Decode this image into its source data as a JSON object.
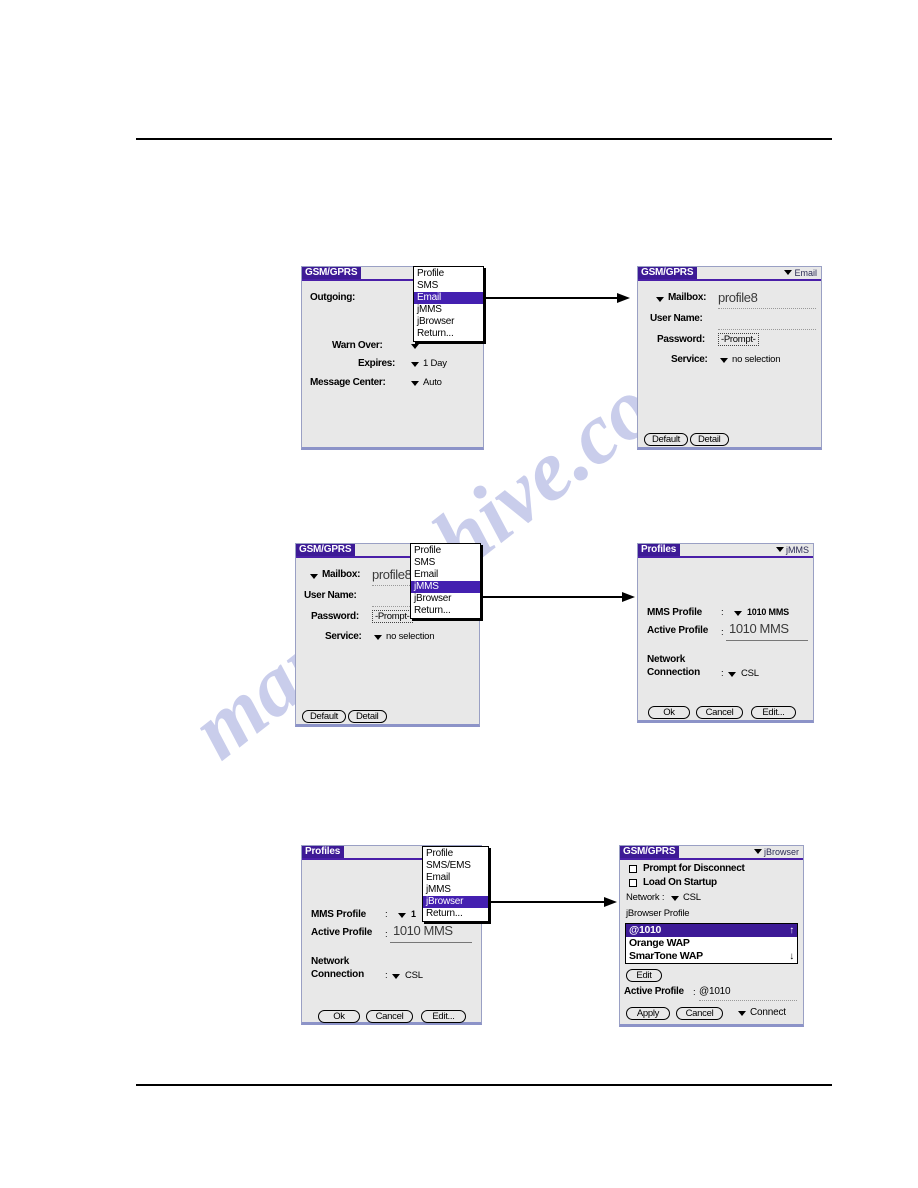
{
  "page": {
    "watermark": "manualshive.com"
  },
  "panels": [
    {
      "id": "panel1",
      "title": "GSM/GPRS",
      "title_right": "",
      "fields": {
        "outgoing_label": "Outgoing:",
        "warn_over_label": "Warn Over:",
        "warn_over_value": "",
        "expires_label": "Expires:",
        "expires_value": "1 Day",
        "message_center_label": "Message Center:",
        "message_center_value": "Auto"
      },
      "menu": {
        "items": [
          "Profile",
          "SMS",
          "Email",
          "jMMS",
          "jBrowser",
          "Return..."
        ],
        "selected": "Email"
      }
    },
    {
      "id": "panel2",
      "title": "GSM/GPRS",
      "title_right": "Email",
      "fields": {
        "mailbox_label": "Mailbox:",
        "mailbox_value": "profile8",
        "user_name_label": "User Name:",
        "user_name_value": "",
        "password_label": "Password:",
        "password_value": "-Prompt-",
        "service_label": "Service:",
        "service_value": "no selection"
      },
      "buttons": [
        "Default",
        "Detail"
      ]
    },
    {
      "id": "panel3",
      "title": "GSM/GPRS",
      "title_right": "",
      "fields": {
        "mailbox_label": "Mailbox:",
        "mailbox_value": "profile8",
        "user_name_label": "User Name:",
        "user_name_value": "",
        "password_label": "Password:",
        "password_value": "-Prompt-",
        "service_label": "Service:",
        "service_value": "no selection"
      },
      "buttons": [
        "Default",
        "Detail"
      ],
      "menu": {
        "items": [
          "Profile",
          "SMS",
          "Email",
          "jMMS",
          "jBrowser",
          "Return..."
        ],
        "selected": "jMMS"
      }
    },
    {
      "id": "panel4",
      "title": "Profiles",
      "title_right": "jMMS",
      "fields": {
        "mms_profile_label": "MMS Profile",
        "mms_profile_value": "1010 MMS",
        "active_profile_label": "Active Profile",
        "active_profile_value": "1010 MMS",
        "network_label_line1": "Network",
        "network_label_line2": "Connection",
        "network_value": "CSL"
      },
      "buttons": [
        "Ok",
        "Cancel",
        "Edit..."
      ]
    },
    {
      "id": "panel5",
      "title": "Profiles",
      "title_right": "",
      "fields": {
        "mms_profile_label": "MMS Profile",
        "mms_profile_value": "1",
        "active_profile_label": "Active Profile",
        "active_profile_value": "1010 MMS",
        "network_label_line1": "Network",
        "network_label_line2": "Connection",
        "network_value": "CSL"
      },
      "buttons": [
        "Ok",
        "Cancel",
        "Edit..."
      ],
      "menu": {
        "items": [
          "Profile",
          "SMS/EMS",
          "Email",
          "jMMS",
          "jBrowser",
          "Return..."
        ],
        "selected": "jBrowser"
      }
    },
    {
      "id": "panel6",
      "title": "GSM/GPRS",
      "title_right": "jBrowser",
      "fields": {
        "prompt_disconnect_label": "Prompt for Disconnect",
        "load_on_startup_label": "Load On Startup",
        "network_label": "Network :",
        "network_value": "CSL",
        "jbrowser_profile_label": "jBrowser Profile",
        "active_profile_label": "Active Profile",
        "active_profile_sep": ":",
        "active_profile_value": "@1010",
        "connect_label": "Connect"
      },
      "profile_list": {
        "items": [
          "@1010",
          "Orange WAP",
          "SmarTone WAP"
        ],
        "selected": "@1010",
        "scroll_up": "↑",
        "scroll_down": "↓"
      },
      "buttons": [
        "Edit",
        "Apply",
        "Cancel"
      ]
    }
  ]
}
